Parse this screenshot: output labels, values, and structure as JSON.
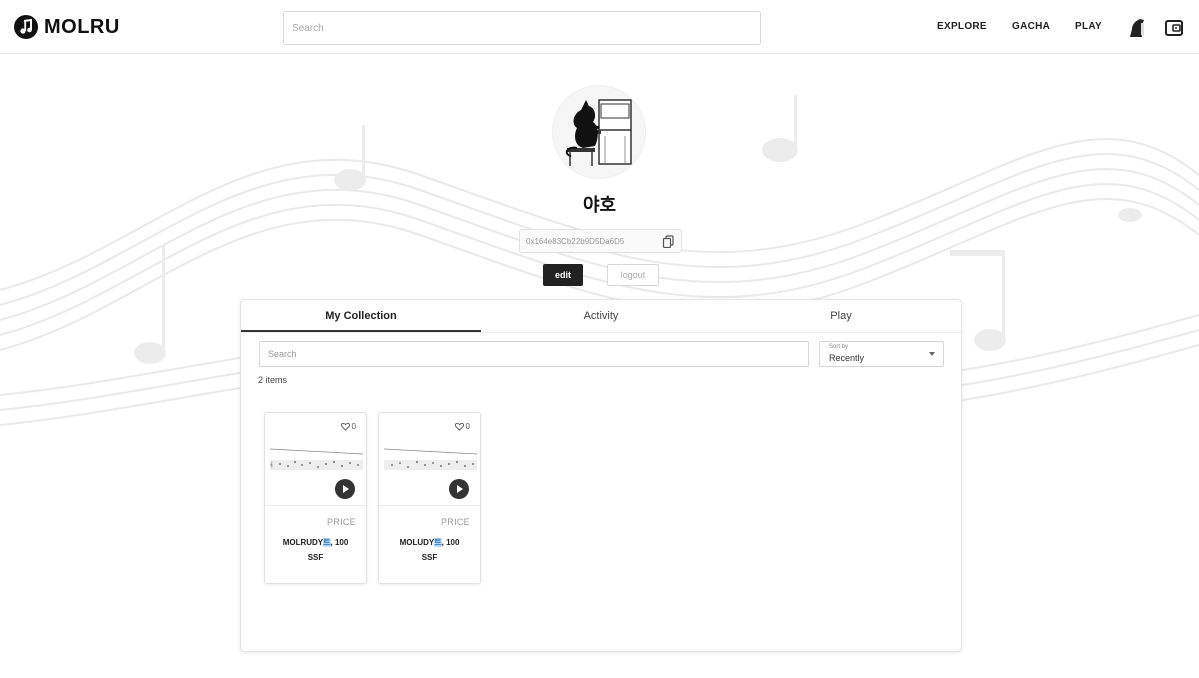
{
  "header": {
    "brand": "MOLRU",
    "search_placeholder": "Search",
    "nav": [
      {
        "label": "EXPLORE"
      },
      {
        "label": "GACHA"
      },
      {
        "label": "PLAY"
      }
    ],
    "icons": [
      "profile-avatar-icon",
      "wallet-icon"
    ]
  },
  "profile": {
    "username": "야호",
    "wallet_address": "0x164e83Cb22b9D5Da6D5",
    "edit_label": "edit",
    "logout_label": "logout"
  },
  "collection": {
    "tabs": [
      {
        "label": "My Collection",
        "active": true
      },
      {
        "label": "Activity",
        "active": false
      },
      {
        "label": "Play",
        "active": false
      }
    ],
    "search_placeholder": "Search",
    "sort": {
      "label": "Sort by",
      "value": "Recently"
    },
    "item_count": "2 items",
    "items": [
      {
        "likes": "0",
        "price_label": "PRICE",
        "name_pre": "MOLRUDY",
        "name_hl": "트",
        "name_post": ", 100",
        "name_line2": "SSF"
      },
      {
        "likes": "0",
        "price_label": "PRICE",
        "name_pre": "MOLUDY",
        "name_hl": "트",
        "name_post": ", 100",
        "name_line2": "SSF"
      }
    ]
  },
  "colors": {
    "primary_button": "#222222",
    "name_highlight": "#bfe0ff"
  }
}
